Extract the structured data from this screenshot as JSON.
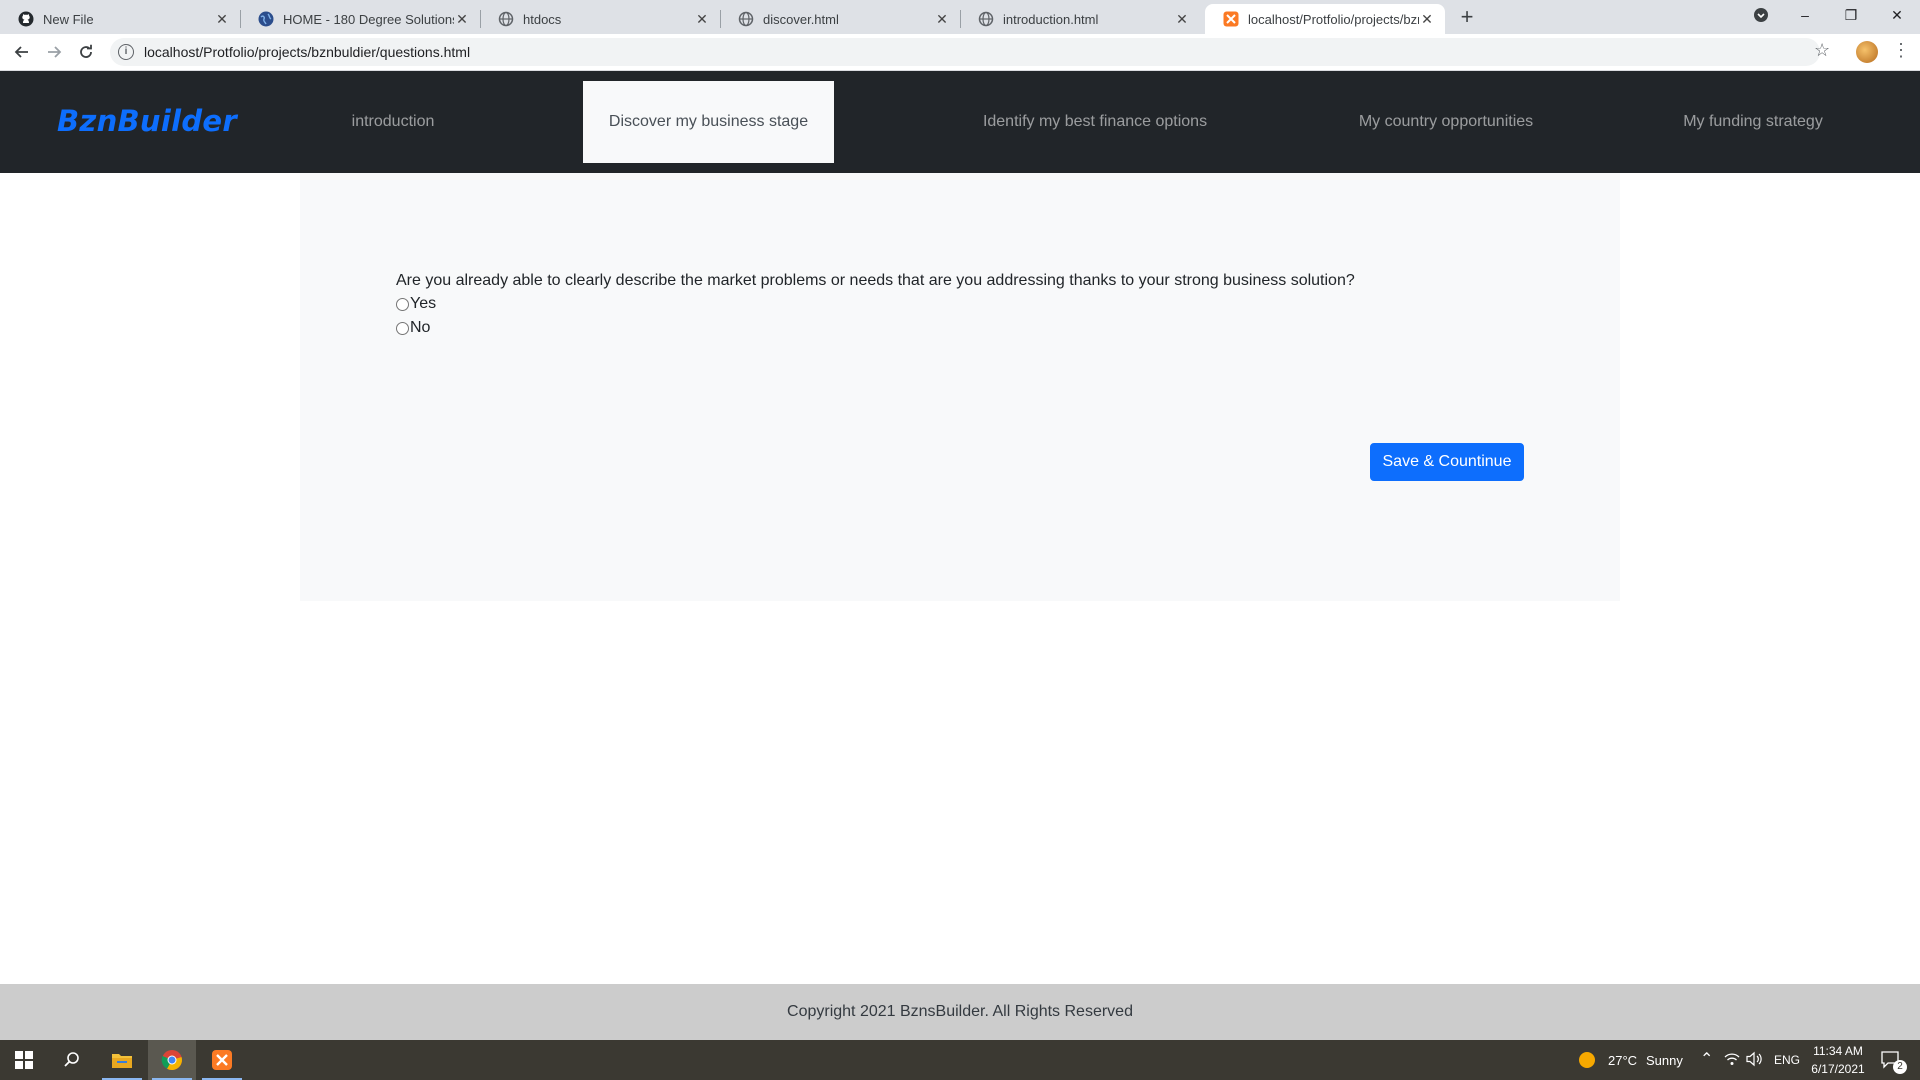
{
  "browser": {
    "tabs": [
      {
        "title": "New File",
        "icon": "github-icon"
      },
      {
        "title": "HOME - 180 Degree Solutions",
        "icon": "globe-icon"
      },
      {
        "title": "htdocs",
        "icon": "globe-icon"
      },
      {
        "title": "discover.html",
        "icon": "globe-icon"
      },
      {
        "title": "introduction.html",
        "icon": "globe-icon"
      },
      {
        "title": "localhost/Protfolio/projects/bznb",
        "icon": "xampp-icon",
        "active": true
      }
    ],
    "new_tab_label": "+",
    "address": "localhost/Protfolio/projects/bznbuldier/questions.html",
    "window_controls": {
      "minimize": "–",
      "restore": "❐",
      "close": "✕"
    }
  },
  "navbar": {
    "brand": "BznBuilder",
    "links": [
      {
        "label": "introduction",
        "active": false
      },
      {
        "label": "Discover my business stage",
        "active": true
      },
      {
        "label": "Identify my best finance options",
        "active": false
      },
      {
        "label": "My country opportunities",
        "active": false
      },
      {
        "label": "My funding strategy",
        "active": false
      }
    ]
  },
  "main": {
    "question": "Are you already able to clearly describe the market problems or needs that are you addressing thanks to your strong business solution?",
    "options": [
      {
        "label": "Yes",
        "checked": false
      },
      {
        "label": "No",
        "checked": false
      }
    ],
    "save_button": "Save & Countinue"
  },
  "footer": {
    "copyright": "Copyright 2021 BznsBuilder. All Rights Reserved"
  },
  "taskbar": {
    "weather_temp": "27°C",
    "weather_desc": "Sunny",
    "language": "ENG",
    "time": "11:34 AM",
    "date": "6/17/2021",
    "notification_count": "2"
  },
  "colors": {
    "brand": "#0d6efd",
    "navbar_bg": "#212529",
    "panel_bg": "#f8f9fa",
    "footer_bg": "#cccccc",
    "taskbar_bg": "#3b3932"
  }
}
